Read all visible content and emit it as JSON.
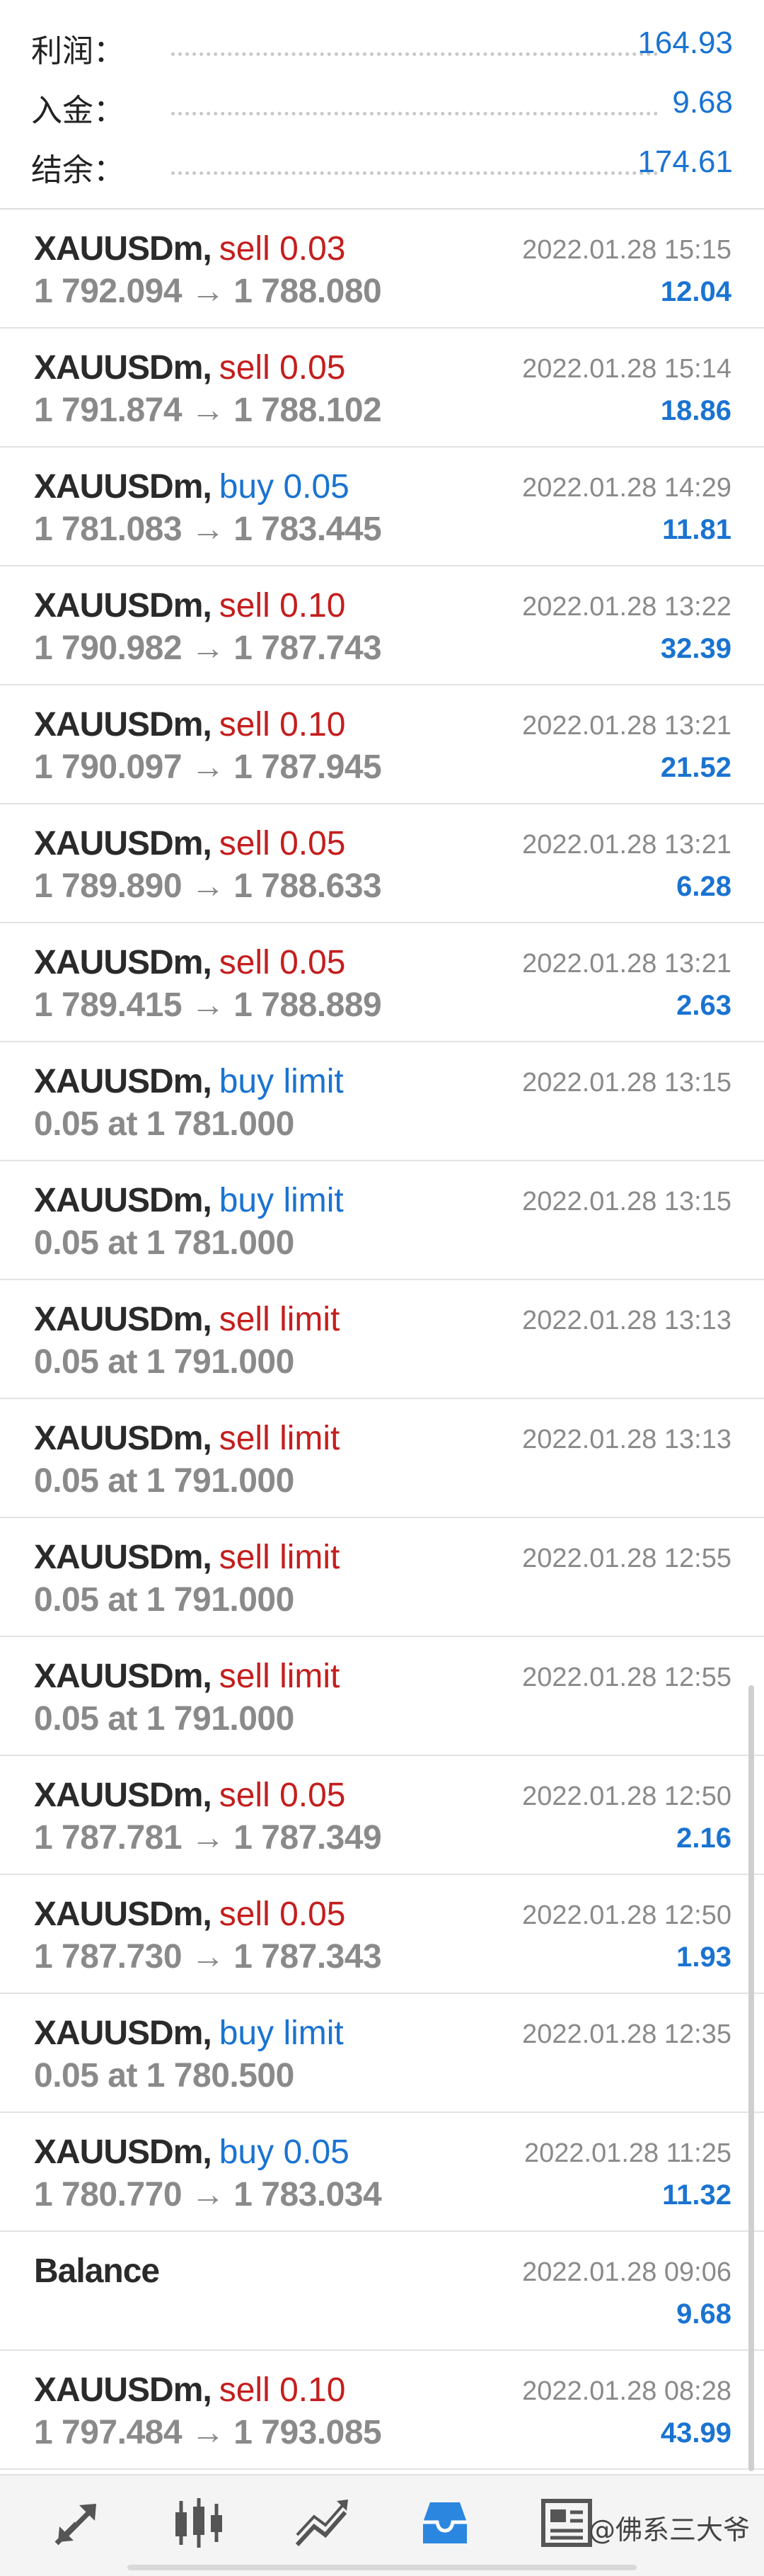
{
  "summary": {
    "profit_label": "利润：",
    "profit_value": "164.93",
    "deposit_label": "入金：",
    "deposit_value": "9.68",
    "balance_label": "结余：",
    "balance_value": "174.61"
  },
  "rows": [
    {
      "symbol": "XAUUSDm",
      "side": "sell 0.03",
      "side_type": "sell",
      "detail": "1 792.094 → 1 788.080",
      "time": "2022.01.28 15:15",
      "profit": "12.04"
    },
    {
      "symbol": "XAUUSDm",
      "side": "sell 0.05",
      "side_type": "sell",
      "detail": "1 791.874 → 1 788.102",
      "time": "2022.01.28 15:14",
      "profit": "18.86"
    },
    {
      "symbol": "XAUUSDm",
      "side": "buy 0.05",
      "side_type": "buy",
      "detail": "1 781.083 → 1 783.445",
      "time": "2022.01.28 14:29",
      "profit": "11.81"
    },
    {
      "symbol": "XAUUSDm",
      "side": "sell 0.10",
      "side_type": "sell",
      "detail": "1 790.982 → 1 787.743",
      "time": "2022.01.28 13:22",
      "profit": "32.39"
    },
    {
      "symbol": "XAUUSDm",
      "side": "sell 0.10",
      "side_type": "sell",
      "detail": "1 790.097 → 1 787.945",
      "time": "2022.01.28 13:21",
      "profit": "21.52"
    },
    {
      "symbol": "XAUUSDm",
      "side": "sell 0.05",
      "side_type": "sell",
      "detail": "1 789.890 → 1 788.633",
      "time": "2022.01.28 13:21",
      "profit": "6.28"
    },
    {
      "symbol": "XAUUSDm",
      "side": "sell 0.05",
      "side_type": "sell",
      "detail": "1 789.415 → 1 788.889",
      "time": "2022.01.28 13:21",
      "profit": "2.63"
    },
    {
      "symbol": "XAUUSDm",
      "side": "buy limit",
      "side_type": "buy",
      "detail": "0.05 at 1 781.000",
      "time": "2022.01.28 13:15",
      "profit": ""
    },
    {
      "symbol": "XAUUSDm",
      "side": "buy limit",
      "side_type": "buy",
      "detail": "0.05 at 1 781.000",
      "time": "2022.01.28 13:15",
      "profit": ""
    },
    {
      "symbol": "XAUUSDm",
      "side": "sell limit",
      "side_type": "sell",
      "detail": "0.05 at 1 791.000",
      "time": "2022.01.28 13:13",
      "profit": ""
    },
    {
      "symbol": "XAUUSDm",
      "side": "sell limit",
      "side_type": "sell",
      "detail": "0.05 at 1 791.000",
      "time": "2022.01.28 13:13",
      "profit": ""
    },
    {
      "symbol": "XAUUSDm",
      "side": "sell limit",
      "side_type": "sell",
      "detail": "0.05 at 1 791.000",
      "time": "2022.01.28 12:55",
      "profit": ""
    },
    {
      "symbol": "XAUUSDm",
      "side": "sell limit",
      "side_type": "sell",
      "detail": "0.05 at 1 791.000",
      "time": "2022.01.28 12:55",
      "profit": ""
    },
    {
      "symbol": "XAUUSDm",
      "side": "sell 0.05",
      "side_type": "sell",
      "detail": "1 787.781 → 1 787.349",
      "time": "2022.01.28 12:50",
      "profit": "2.16"
    },
    {
      "symbol": "XAUUSDm",
      "side": "sell 0.05",
      "side_type": "sell",
      "detail": "1 787.730 → 1 787.343",
      "time": "2022.01.28 12:50",
      "profit": "1.93"
    },
    {
      "symbol": "XAUUSDm",
      "side": "buy limit",
      "side_type": "buy",
      "detail": "0.05 at 1 780.500",
      "time": "2022.01.28 12:35",
      "profit": ""
    },
    {
      "symbol": "XAUUSDm",
      "side": "buy 0.05",
      "side_type": "buy",
      "detail": "1 780.770 → 1 783.034",
      "time": "2022.01.28 11:25",
      "profit": "11.32"
    },
    {
      "symbol": "Balance",
      "side": "",
      "side_type": "",
      "detail": "",
      "time": "2022.01.28 09:06",
      "profit": "9.68"
    },
    {
      "symbol": "XAUUSDm",
      "side": "sell 0.10",
      "side_type": "sell",
      "detail": "1 797.484 → 1 793.085",
      "time": "2022.01.28 08:28",
      "profit": "43.99"
    }
  ],
  "nav": {
    "items": [
      {
        "name": "quotes",
        "icon": "quotes-arrows-icon",
        "active": false
      },
      {
        "name": "chart",
        "icon": "candlestick-chart-icon",
        "active": false
      },
      {
        "name": "trade",
        "icon": "trade-trend-icon",
        "active": false
      },
      {
        "name": "history",
        "icon": "history-inbox-icon",
        "active": true
      },
      {
        "name": "news",
        "icon": "news-icon",
        "active": false
      }
    ],
    "watermark": "@佛系三大爷"
  },
  "colors": {
    "sell": "#c41e1e",
    "buy": "#1a73d1",
    "accent": "#1a73d1",
    "muted": "#8a8a8a"
  }
}
